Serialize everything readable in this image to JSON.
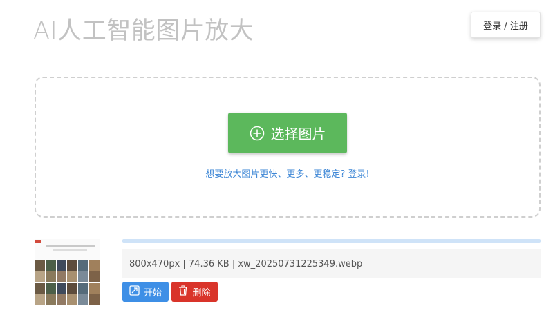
{
  "header": {
    "title": "AI人工智能图片放大",
    "login_label": "登录 / 注册"
  },
  "upload": {
    "select_label": "选择图片",
    "hint": "想要放大图片更快、更多、更稳定? 登录!"
  },
  "file": {
    "info": "800x470px | 74.36 KB | xw_20250731225349.webp",
    "progress": 1.0,
    "start_label": "开始",
    "delete_label": "删除"
  },
  "icons": {
    "select": "plus-circle-icon",
    "start": "expand-icon",
    "delete": "trash-icon"
  },
  "colors": {
    "select_button": "#5cb85c",
    "start_button": "#3e8fe6",
    "delete_button": "#d9342a",
    "hint_link": "#3e87d6",
    "progress": "#cfe3f8"
  }
}
